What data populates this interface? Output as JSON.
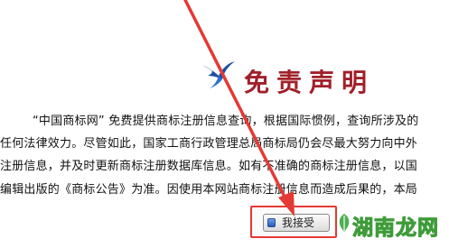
{
  "header": {
    "title": "免责声明",
    "logo_icon": "swallow-bird-icon"
  },
  "body_text": {
    "lines": [
      "“中国商标网” 免费提供商标注册信息查询，根据国际惯例，查询所涉及的",
      "任何法律效力。尽管如此，国家工商行政管理总局商标局仍会尽最大努力向中外",
      "注册信息，并及时更新商标注册数据库信息。如有不准确的商标注册信息，以国",
      "编辑出版的《商标公告》为准。因使用本网站商标注册信息而造成后果的，本局"
    ]
  },
  "accept_button": {
    "label": "我接受",
    "highlight_color": "#e53935"
  },
  "annotation": {
    "arrow_color": "#e53935"
  },
  "watermark": {
    "text": "湖南龙网",
    "color": "#3f9b3a"
  },
  "colors": {
    "title": "#a1202a",
    "logo": "#1e4fa3"
  }
}
